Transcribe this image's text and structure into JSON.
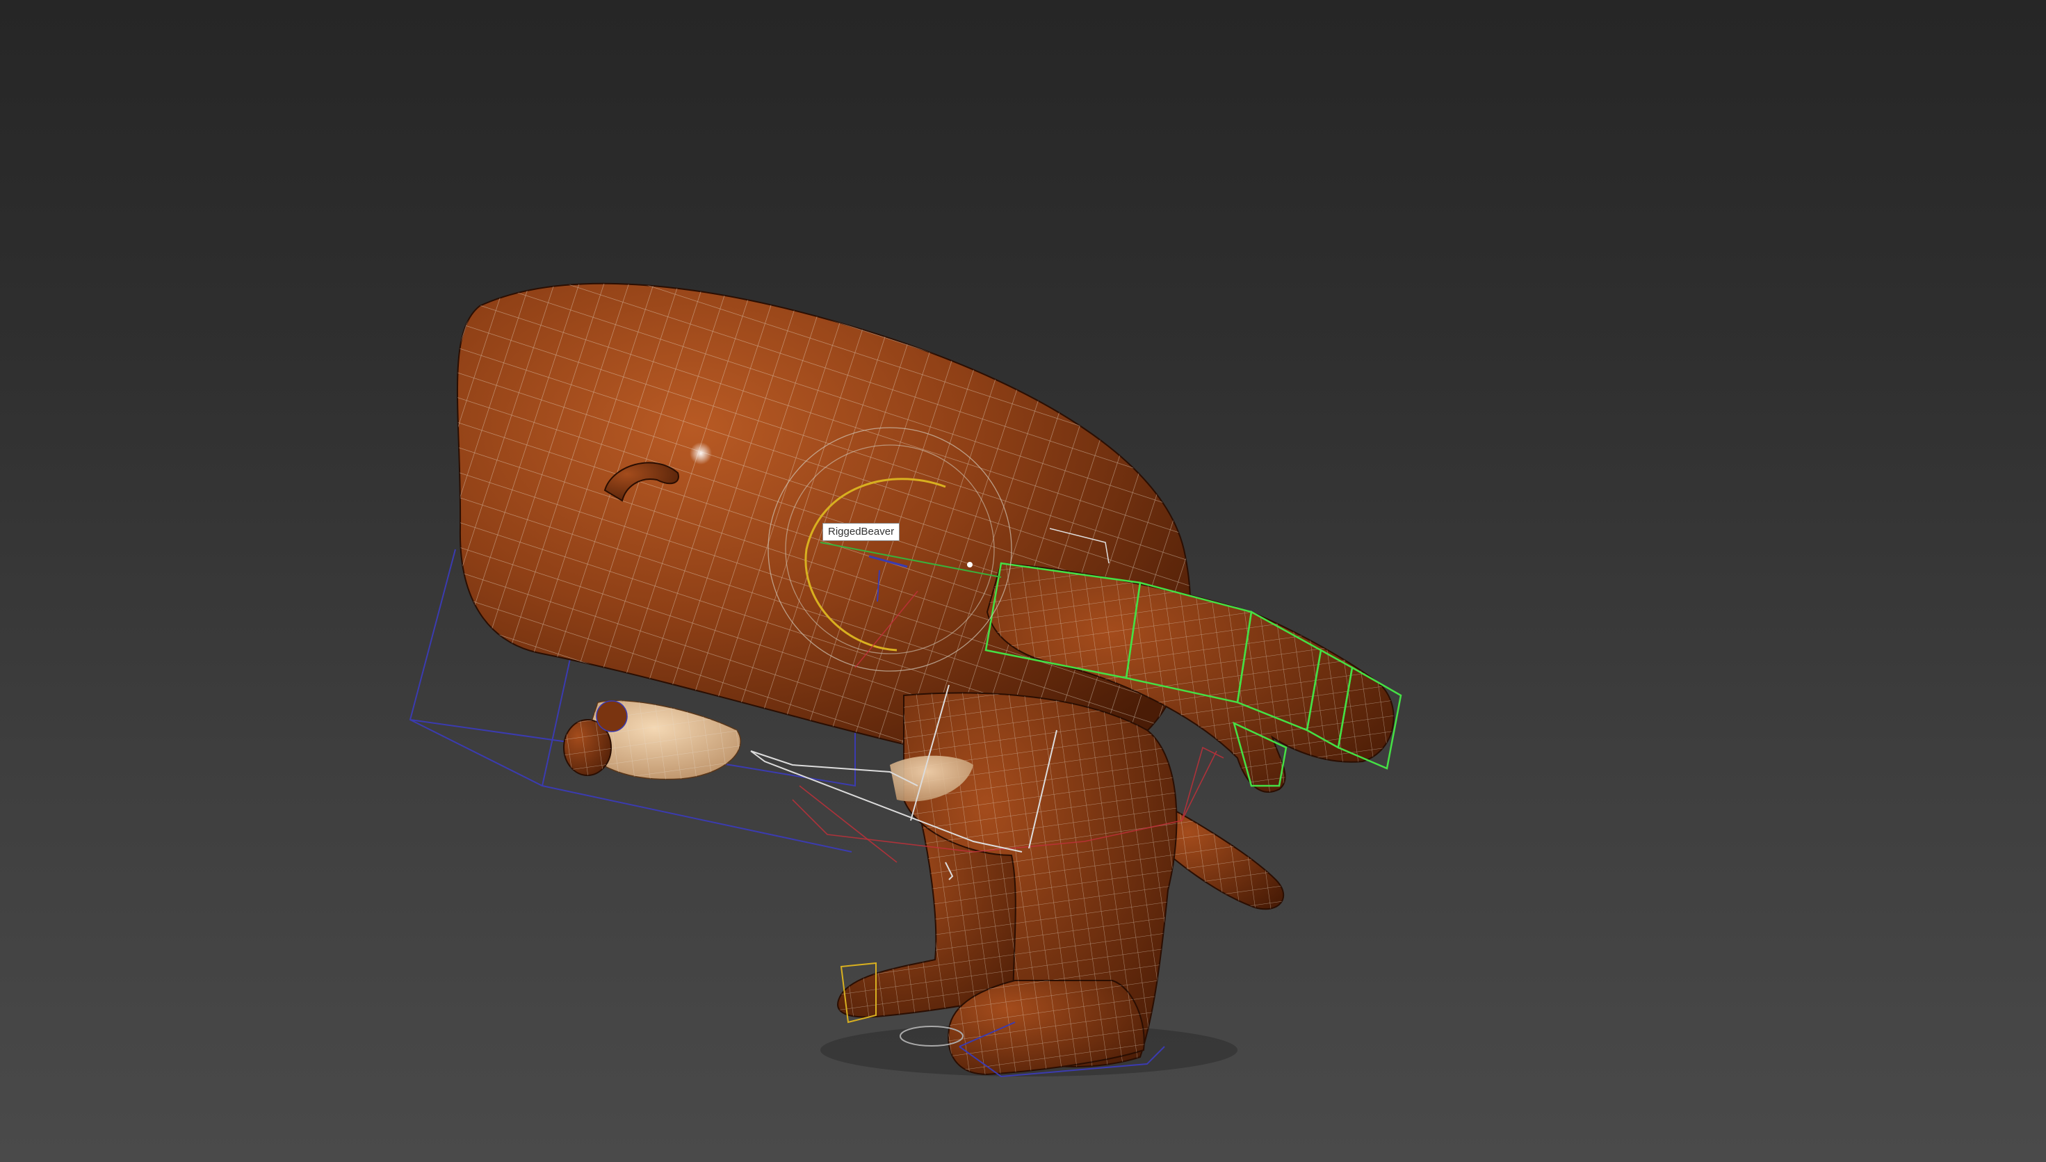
{
  "viewport": {
    "object_label": "RiggedBeaver",
    "colors": {
      "background_top": "#262626",
      "background_bottom": "#4a4a4a",
      "body_shade": "#8f3f15",
      "belly_shade": "#e8c49c",
      "wireframe": "#e6dccf",
      "bone_controls_blue": "#3b3bb0",
      "hand_controls_green": "#45e045",
      "ik_circle_yellow": "#d8b020",
      "helper_red": "#c0303a"
    }
  }
}
